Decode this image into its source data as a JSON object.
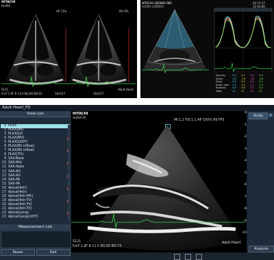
{
  "top_left": {
    "brand": "HITACHI",
    "brand_sub": "ALOKA",
    "ap_label": "AP 72%",
    "fps_label": "69 FPS",
    "left_probe": "S121",
    "left_params": "FmT-1.9F   R 13.0 BG:60 BD:55",
    "left_date": "16/2/17",
    "right_date": "16/2/17",
    "preset": "Adult Heart"
  },
  "top_right": {
    "brand": "HITACHI LISENDO 880",
    "sub": "ALOKA LISENDO",
    "time": "02:37:17",
    "date": "12.04.80",
    "table_rows": [
      [
        "Velocity",
        "4.5",
        "4.7",
        "4.0",
        "4.2"
      ],
      [
        "Strain",
        "-20",
        "-19",
        "-16",
        "-18"
      ],
      [
        "Displ.",
        "5.8",
        "5.3",
        "4.9",
        "5.1"
      ],
      [
        "Strain rate",
        "1.4",
        "1.5",
        "1.2",
        "1.3"
      ],
      [
        "Rotation",
        "3.8",
        "3.6",
        "3.2",
        "3.4"
      ],
      [
        "Twist",
        "12",
        "11",
        "10",
        "11"
      ]
    ],
    "series_colors": [
      "#3bd6ff",
      "#ffe34d",
      "#ff4dd6",
      "#7dff5a"
    ]
  },
  "app": {
    "title": "Adult Heart_FD",
    "view_list_title": "View List",
    "view_list": [
      "PLAX",
      "PLAX(Ao)",
      "PLAX(LV)",
      "PLAX(MV)",
      "PLAX(LVOT)",
      "PLAX(RV inflow)",
      "PLAX(RV inflow)",
      "PLAX(TV)",
      "SAX-Base",
      "SAX-Mid",
      "SAX-Apex",
      "SAX-AO",
      "SAX-AO",
      "SAX-PA",
      "SAX-PA",
      "Apical(4ch)",
      "Apical(4ch)",
      "Apical(4ch-MV)",
      "Apical(4ch-TV)",
      "Apical(4ch-TV)",
      "Apical(4ch-TV)",
      "Apical(Long)",
      "Apical(Long)(VOT)"
    ],
    "measurement_list_title": "Measurement List",
    "pause_label": "Pause",
    "exit_label": "Exit",
    "image_brand": "HITACHI",
    "image_brand_sub": "ALOKA-FA",
    "info_line": "MI 1.2  TIS 1.1   AP 100%    69 FPS",
    "probe": "S121",
    "params": "FmT-1.9F   R 11.0 BG:60 BD:73",
    "preset": "Adult Heart",
    "study_label": "Study",
    "analysis_label": "Analysis",
    "depth_ticks": [
      "0",
      "-1",
      "-2",
      "-3",
      "-4",
      "-5",
      "-6",
      "-7",
      "-8",
      "-9",
      "-10"
    ]
  }
}
